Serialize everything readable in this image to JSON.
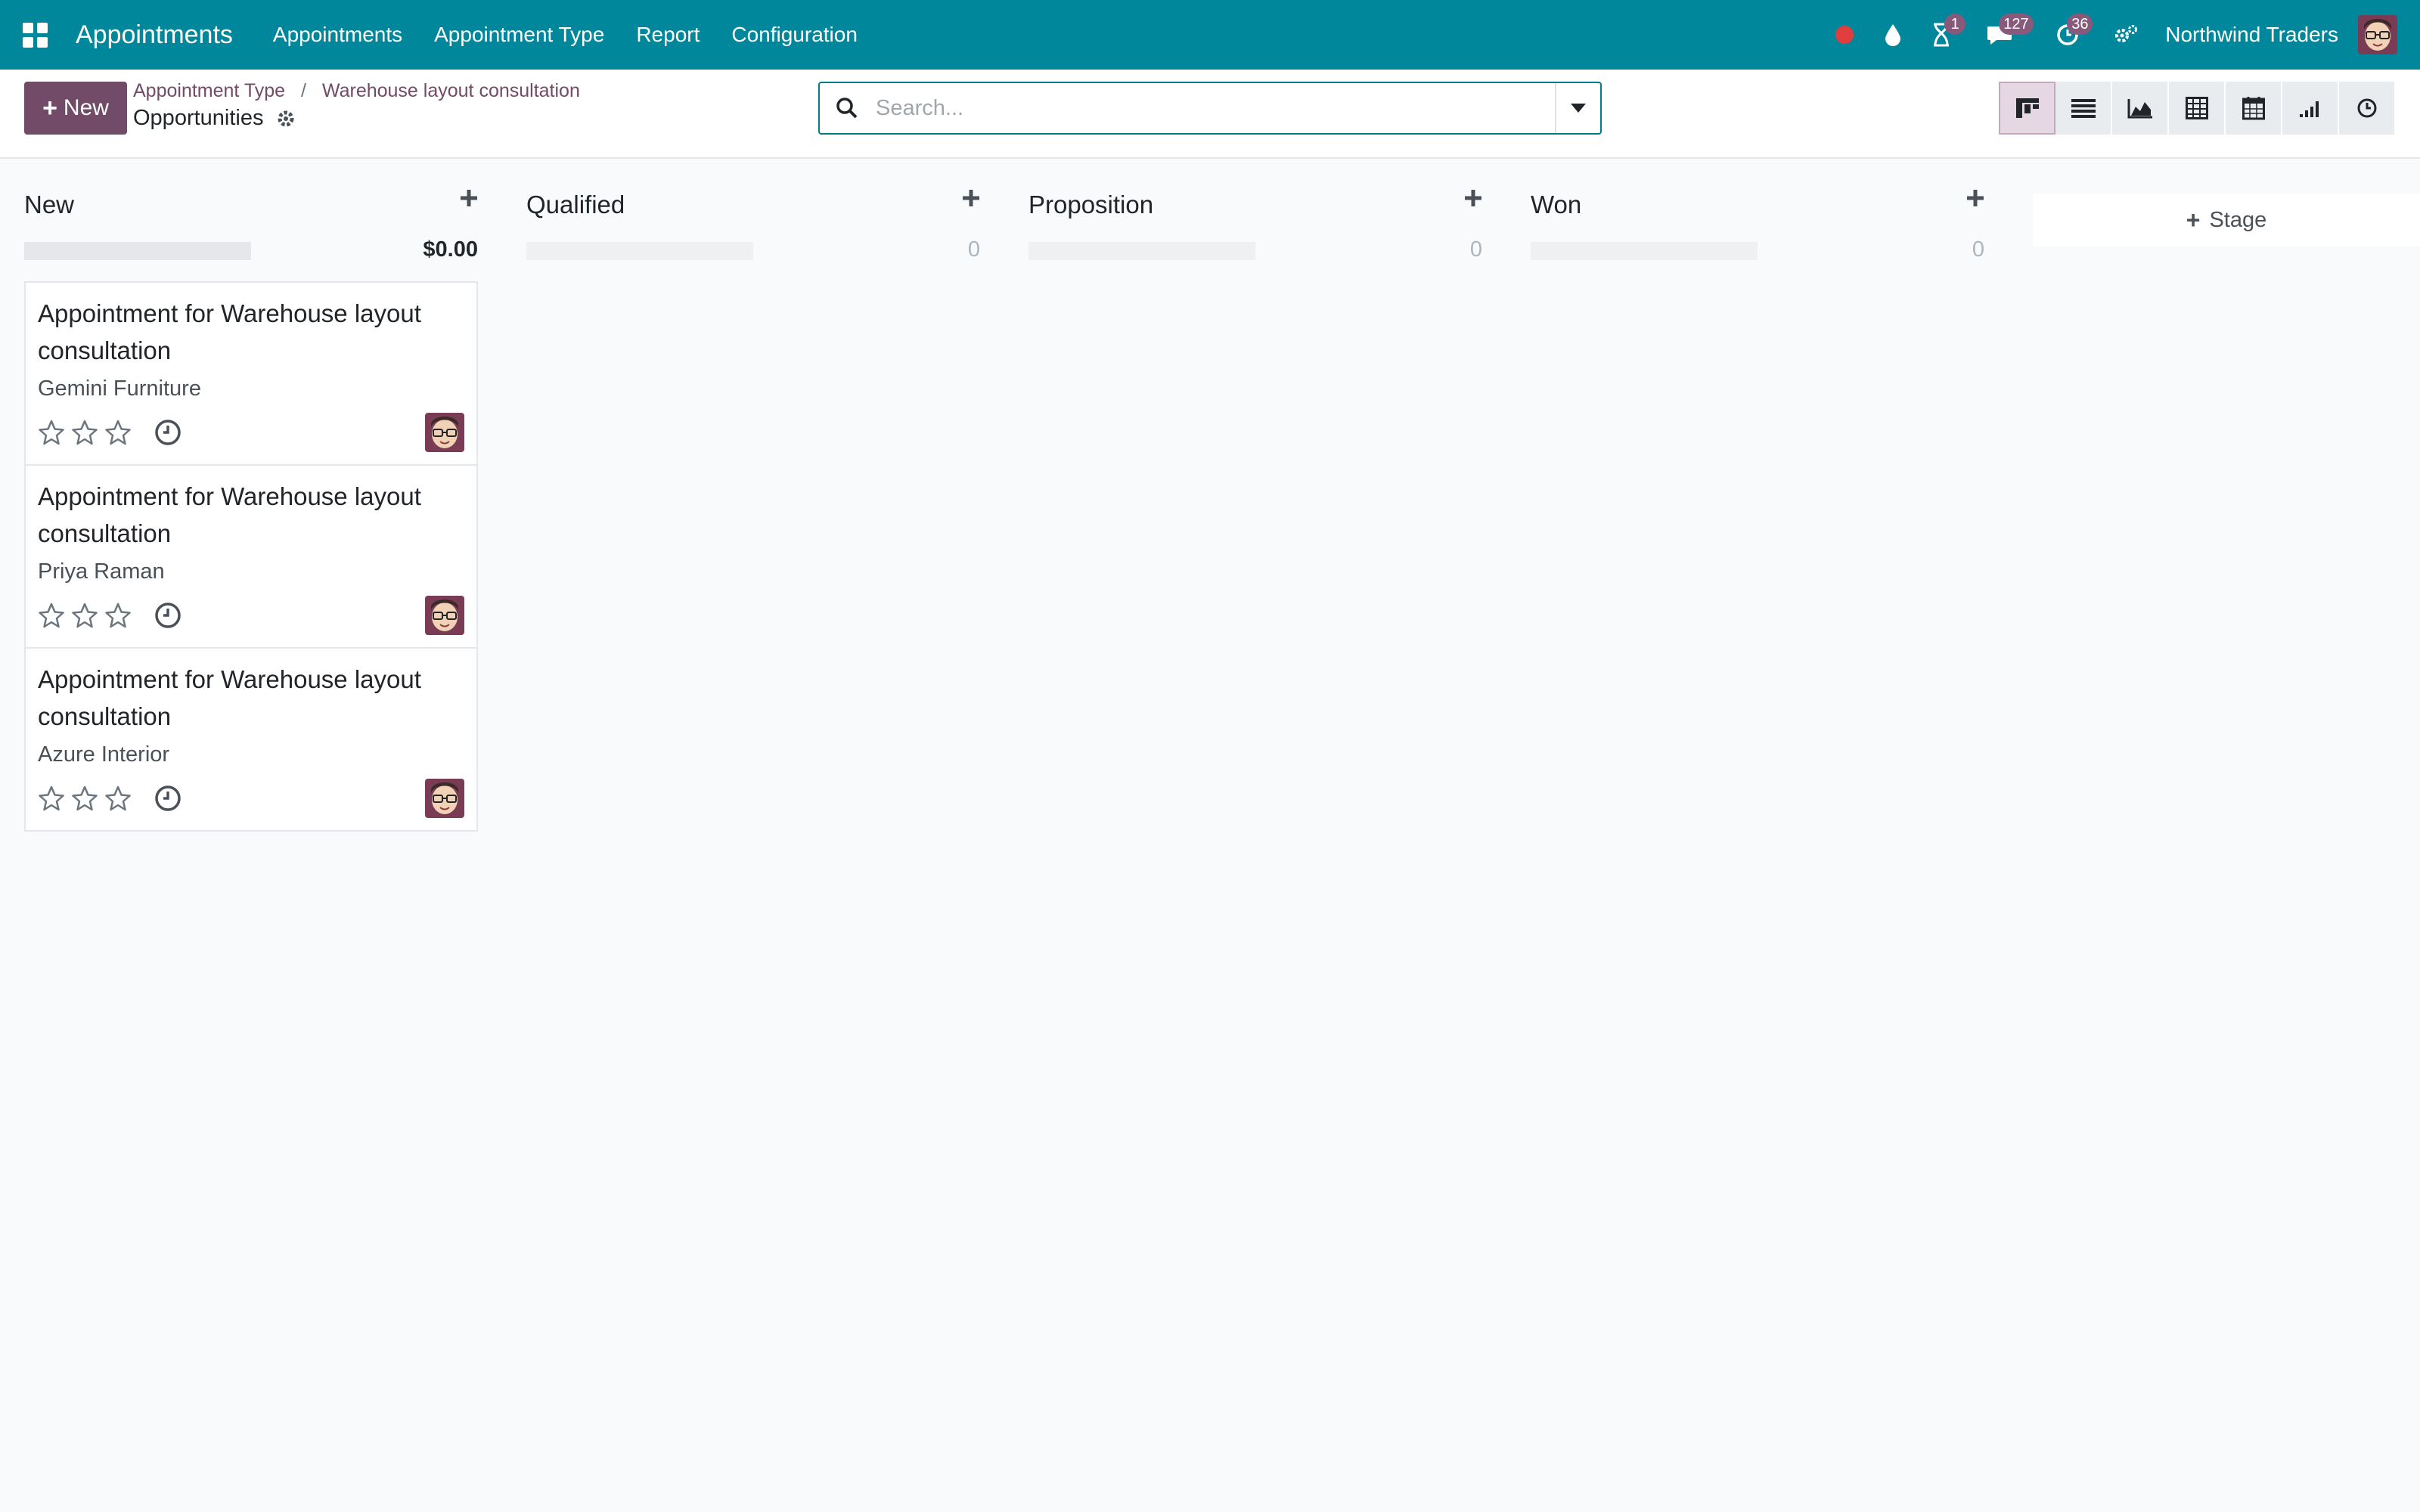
{
  "navbar": {
    "brand": "Appointments",
    "menu": [
      "Appointments",
      "Appointment Type",
      "Report",
      "Configuration"
    ],
    "activity_badge": "1",
    "messages_badge": "127",
    "timer_badge": "36",
    "company": "Northwind Traders",
    "status_color": "#e03e3e"
  },
  "control_panel": {
    "new_label": "New",
    "breadcrumb": [
      "Appointment Type",
      "Warehouse layout consultation"
    ],
    "breadcrumb_separator": "/",
    "subtitle": "Opportunities",
    "search_placeholder": "Search..."
  },
  "views": [
    "kanban",
    "list",
    "graph",
    "pivot",
    "calendar",
    "cohort",
    "activity"
  ],
  "kanban": {
    "columns": [
      {
        "title": "New",
        "total": "$0.00",
        "cards": [
          {
            "title": "Appointment for Warehouse layout consultation",
            "partner": "Gemini Furniture",
            "rating": 0
          },
          {
            "title": "Appointment for Warehouse layout consultation",
            "partner": "Priya Raman",
            "rating": 0
          },
          {
            "title": "Appointment for Warehouse layout consultation",
            "partner": "Azure Interior",
            "rating": 0
          }
        ]
      },
      {
        "title": "Qualified",
        "total": "0",
        "cards": []
      },
      {
        "title": "Proposition",
        "total": "0",
        "cards": []
      },
      {
        "title": "Won",
        "total": "0",
        "cards": []
      }
    ],
    "add_stage_label": "Stage"
  },
  "colors": {
    "navbar": "#00879b",
    "primary": "#714b67",
    "badge": "#875a7b"
  }
}
